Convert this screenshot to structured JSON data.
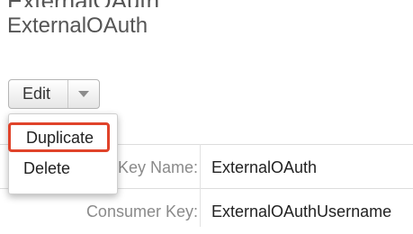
{
  "top_cropped_text": "ExternalOAuth",
  "page_title": "ExternalOAuth",
  "actions": {
    "edit_label": "Edit",
    "menu": [
      "Duplicate",
      "Delete"
    ],
    "highlighted_item": "Duplicate",
    "highlight_color": "#e0432a"
  },
  "fields": [
    {
      "label": "Key Name:",
      "value": "ExternalOAuth"
    },
    {
      "label": "Consumer Key:",
      "value": "ExternalOAuthUsername"
    }
  ],
  "icons": {
    "dropdown_caret": "chevron-down-icon"
  }
}
